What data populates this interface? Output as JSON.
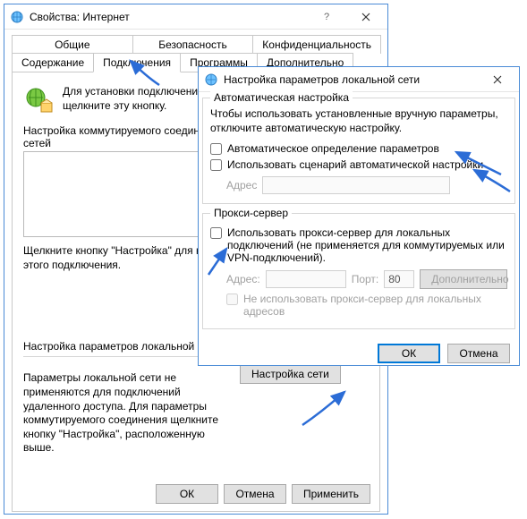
{
  "main": {
    "title": "Свойства: Интернет",
    "tabs": {
      "row1": [
        "Общие",
        "Безопасность",
        "Конфиденциальность"
      ],
      "row2": [
        "Содержание",
        "Подключения",
        "Программы",
        "Дополнительно"
      ],
      "active": "Подключения"
    },
    "intro_text": "Для установки подключения компьютера к Интернету щелкните эту кнопку.",
    "dialup_label": "Настройка коммутируемого соединения и виртуальных частных сетей",
    "settings_hint": "Щелкните кнопку \"Настройка\" для настройки прокси-сервера для этого подключения.",
    "lan_section_label": "Настройка параметров локальной сети",
    "lan_hint": "Параметры локальной сети не применяются для подключений удаленного доступа. Для параметры коммутируемого соединения щелкните кнопку \"Настройка\", расположенную выше.",
    "lan_button": "Настройка сети",
    "ok": "ОК",
    "cancel": "Отмена",
    "apply": "Применить"
  },
  "modal": {
    "title": "Настройка параметров локальной сети",
    "auto": {
      "legend": "Автоматическая настройка",
      "text": "Чтобы использовать установленные вручную параметры, отключите автоматическую настройку.",
      "chk_autodetect": "Автоматическое определение параметров",
      "chk_script": "Использовать сценарий автоматической настройки",
      "address_label": "Адрес"
    },
    "proxy": {
      "legend": "Прокси-сервер",
      "chk_use": "Использовать прокси-сервер для локальных подключений (не применяется для коммутируемых или VPN-подключений).",
      "address_label": "Адрес:",
      "port_label": "Порт:",
      "port_value": "80",
      "advanced": "Дополнительно",
      "chk_bypass": "Не использовать прокси-сервер для локальных адресов"
    },
    "ok": "ОК",
    "cancel": "Отмена"
  }
}
